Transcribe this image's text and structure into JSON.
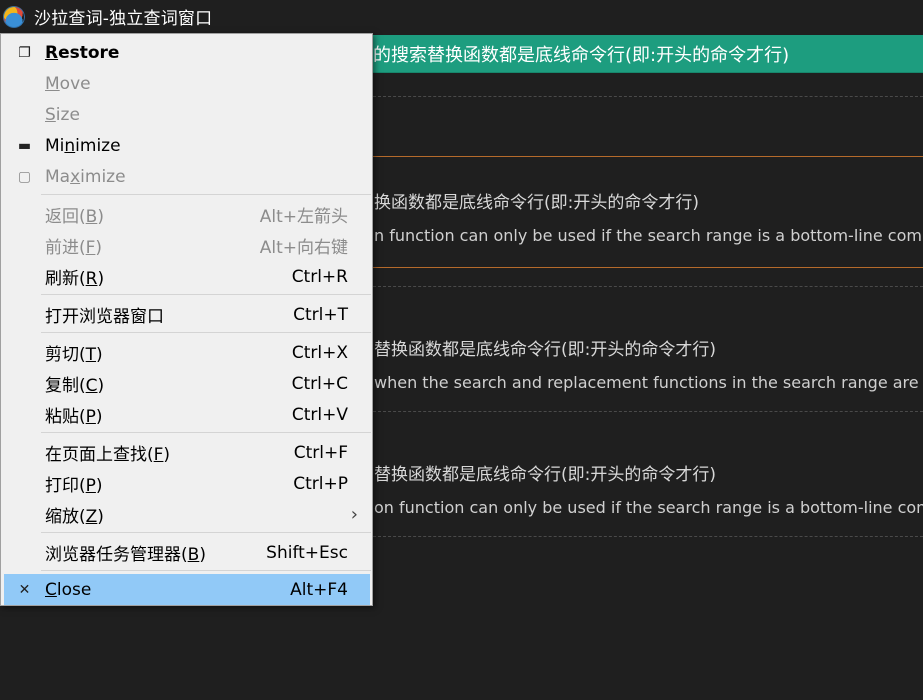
{
  "window": {
    "title": "沙拉查词-独立查词窗口"
  },
  "content": {
    "banner": "的搜索替换函数都是底线命令行(即:开头的命令才行)",
    "entries": [
      {
        "zh": "换函数都是底线命令行(即:开头的命令才行)",
        "en": "n function can only be used if the search range is a bottom-line comma"
      },
      {
        "zh": "替换函数都是底线命令行(即:开头的命令才行)",
        "en": "when the search and replacement functions in the search range are a"
      },
      {
        "zh": "替换函数都是底线命令行(即:开头的命令才行)",
        "en": "on function can only be used if the search range is a bottom-line comm"
      }
    ]
  },
  "menu": {
    "restore": {
      "pre": "",
      "key": "R",
      "post": "estore"
    },
    "move": {
      "pre": "",
      "key": "M",
      "post": "ove"
    },
    "size": {
      "pre": "",
      "key": "S",
      "post": "ize"
    },
    "minimize": {
      "pre": "Mi",
      "key": "n",
      "post": "imize"
    },
    "maximize": {
      "pre": "Ma",
      "key": "x",
      "post": "imize"
    },
    "back": {
      "pre": "返回(",
      "key": "B",
      "post": ")",
      "shortcut": "Alt+左箭头"
    },
    "forward": {
      "pre": "前进(",
      "key": "F",
      "post": ")",
      "shortcut": "Alt+向右键"
    },
    "refresh": {
      "pre": "刷新(",
      "key": "R",
      "post": ")",
      "shortcut": "Ctrl+R"
    },
    "open_browser": {
      "label": "打开浏览器窗口",
      "shortcut": "Ctrl+T"
    },
    "cut": {
      "pre": "剪切(",
      "key": "T",
      "post": ")",
      "shortcut": "Ctrl+X"
    },
    "copy": {
      "pre": "复制(",
      "key": "C",
      "post": ")",
      "shortcut": "Ctrl+C"
    },
    "paste": {
      "pre": "粘贴(",
      "key": "P",
      "post": ")",
      "shortcut": "Ctrl+V"
    },
    "find": {
      "pre": "在页面上查找(",
      "key": "F",
      "post": ")",
      "shortcut": "Ctrl+F"
    },
    "print": {
      "pre": "打印(",
      "key": "P",
      "post": ")",
      "shortcut": "Ctrl+P"
    },
    "zoom": {
      "pre": "缩放(",
      "key": "Z",
      "post": ")",
      "arrow": "›"
    },
    "task_manager": {
      "pre": "浏览器任务管理器(",
      "key": "B",
      "post": ")",
      "shortcut": "Shift+Esc"
    },
    "close": {
      "pre": "",
      "key": "C",
      "post": "lose",
      "shortcut": "Alt+F4"
    }
  },
  "icons": {
    "restore": "❐",
    "minimize": "▬",
    "maximize": "▢",
    "close": "✕"
  }
}
